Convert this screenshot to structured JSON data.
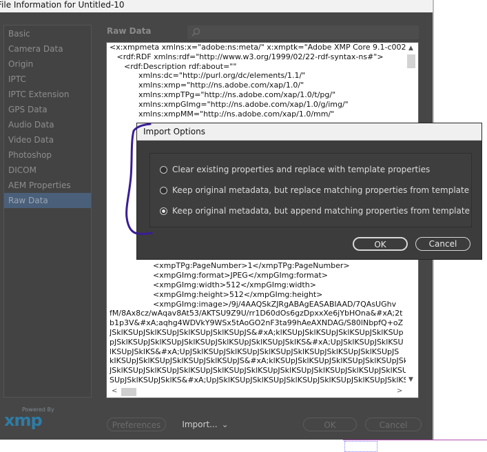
{
  "window": {
    "title": "File Information for Untitled-10"
  },
  "sidebar": {
    "items": [
      {
        "label": "Basic"
      },
      {
        "label": "Camera Data"
      },
      {
        "label": "Origin"
      },
      {
        "label": "IPTC"
      },
      {
        "label": "IPTC Extension"
      },
      {
        "label": "GPS Data"
      },
      {
        "label": "Audio Data"
      },
      {
        "label": "Video Data"
      },
      {
        "label": "Photoshop"
      },
      {
        "label": "DICOM"
      },
      {
        "label": "AEM Properties"
      },
      {
        "label": "Raw Data"
      }
    ],
    "active_index": 11
  },
  "main": {
    "section_title": "Raw Data",
    "search_placeholder": "",
    "xml_lines": [
      "<x:xmpmeta xmlns:x=\"adobe:ns:meta/\" x:xmptk=\"Adobe XMP Core 9.1-c002",
      "   <rdf:RDF xmlns:rdf=\"http://www.w3.org/1999/02/22-rdf-syntax-ns#\">",
      "      <rdf:Description rdf:about=\"\"",
      "            xmlns:dc=\"http://purl.org/dc/elements/1.1/\"",
      "            xmlns:xmp=\"http://ns.adobe.com/xap/1.0/\"",
      "            xmlns:xmpTPg=\"http://ns.adobe.com/xap/1.0/t/pg/\"",
      "            xmlns:xmpGImg=\"http://ns.adobe.com/xap/1.0/g/img/\"",
      "            xmlns:xmpMM=\"http://ns.adobe.com/xap/1.0/mm/\"",
      "",
      "",
      "",
      "",
      "",
      "",
      "",
      "",
      "",
      "",
      "",
      "",
      "",
      "",
      "",
      "                  <xmpTPg:PageNumber>1</xmpTPg:PageNumber>",
      "                  <xmpGImg:format>JPEG</xmpGImg:format>",
      "                  <xmpGImg:width>512</xmpGImg:width>",
      "                  <xmpGImg:height>512</xmpGImg:height>",
      "                  <xmpGImg:image>/9j/4AAQSkZJRgABAgEASABIAAD/7QAsUGhv",
      "fM/8Ax8cz/wAqav8At53/AKTSU9Z9U/rr1D60dOs6gzDpxxXe6jYbHOna&#xA;2t",
      "b1p3V&#xA;aqhg4WDVkY9WSx5tAoGO2nF3ta99hAeAXNDAG/S80lNbpfQ+oZ",
      "JSklKSUpJSklKSUpJSklKSUpJSklKSUpJS&#xA;klKSUpJSklKSUpJSklKSUpJSklKSUp",
      "pJSklKSUpJSklKSUpJSklKSUpJSklKSUpJSklKSUpJSklKS&#xA;UpJSklKSUpJSklKSU",
      "lKSUpJSklKS&#xA;UpJSklKSUpJSklKSUpJSklKSUpJSklKSUpJSklKSUpJSklKSUpJS",
      "kIKSUpJSklKSUpJSklKSUpJSklKSUpJS&#xA;klKSUpJSklKSUpJSklKSUpJSklKSUpJSk",
      "JSklKSUpJSklKSUpJSklKSUpJSklKSUpJSklKSUpJSklKSUpJSklKSUpJSklKSUpJSklKSUp&",
      "SUpJSklKSUpJSklKS&#xA;UpJSklKSUpJSklKSUpJSklKSUpJSklKSUpJSklKSUpJSklKSUpJSklK",
      "KSUpJSklKSUpJSklKSUpJSklKSUpJSklKSUpJS&#xA;klKSUpJSklKSUpJSklK"
    ]
  },
  "footer": {
    "powered_by": "Powered By",
    "xmp_logo": "xmp",
    "preferences_label": "Preferences",
    "import_label": "Import...",
    "ok_label": "OK",
    "cancel_label": "Cancel"
  },
  "dialog": {
    "title": "Import Options",
    "options": [
      {
        "label": "Clear existing properties and replace with template properties",
        "checked": false
      },
      {
        "label": "Keep original metadata, but replace matching properties from template",
        "checked": false
      },
      {
        "label": "Keep original metadata, but append matching properties from template",
        "checked": true
      }
    ],
    "ok_label": "OK",
    "cancel_label": "Cancel"
  },
  "colors": {
    "annotation": "#3a1d96",
    "active_sidebar": "#4a5f79",
    "xmp_blue": "#2f7ca6"
  }
}
